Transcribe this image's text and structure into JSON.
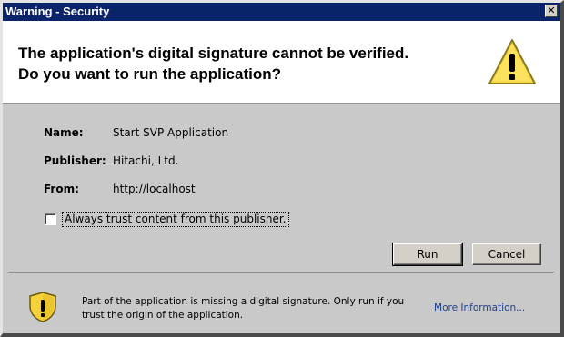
{
  "window": {
    "title": "Warning - Security",
    "close_glyph": "✕"
  },
  "header": {
    "line1": "The application's digital signature cannot be verified.",
    "line2": "Do you want to run the application?",
    "icon": "warning-triangle-icon",
    "icon_color": "#f7d84a"
  },
  "details": {
    "name_label": "Name:",
    "name_value": "Start SVP Application",
    "publisher_label": "Publisher:",
    "publisher_value": "Hitachi, Ltd.",
    "from_label": "From:",
    "from_value": "http://localhost"
  },
  "trust_checkbox": {
    "checked": false,
    "label": "Always trust content from this publisher."
  },
  "buttons": {
    "run": "Run",
    "cancel": "Cancel"
  },
  "footer": {
    "icon": "shield-warning-icon",
    "message": "Part of the application is missing a digital signature.  Only run if you trust the origin of the application.",
    "more_info_first": "M",
    "more_info_rest": "ore Information..."
  },
  "colors": {
    "titlebar": "#0a246a",
    "dialog_bg": "#c9c9c9",
    "link": "#1f3f8f"
  }
}
